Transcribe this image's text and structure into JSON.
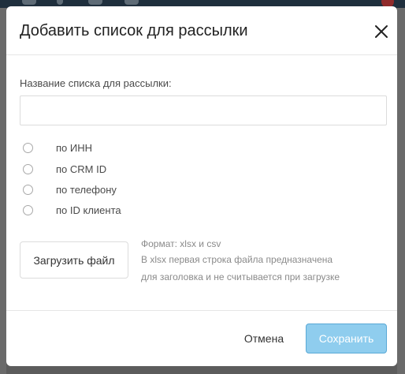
{
  "modal": {
    "title": "Добавить список для рассылки",
    "name_label": "Название списка для рассылки:",
    "name_value": "",
    "name_placeholder": "",
    "options": [
      {
        "label": "по ИНН",
        "selected": false
      },
      {
        "label": "по CRM ID",
        "selected": false
      },
      {
        "label": "по телефону",
        "selected": false
      },
      {
        "label": "по ID клиента",
        "selected": false
      }
    ],
    "upload_label": "Загрузить файл",
    "hint_format": "Формат: xlsx и csv",
    "hint_line1": "В xlsx первая строка файла предназначена",
    "hint_line2": "для заголовка и не считывается при загрузке",
    "cancel_label": "Отмена",
    "save_label": "Сохранить",
    "close_icon": "close-icon"
  },
  "colors": {
    "save_button_bg": "#8fcdee",
    "save_button_border": "#5aa9d6",
    "backdrop": "#5c5c5c",
    "topbar": "#1f2f3d"
  }
}
